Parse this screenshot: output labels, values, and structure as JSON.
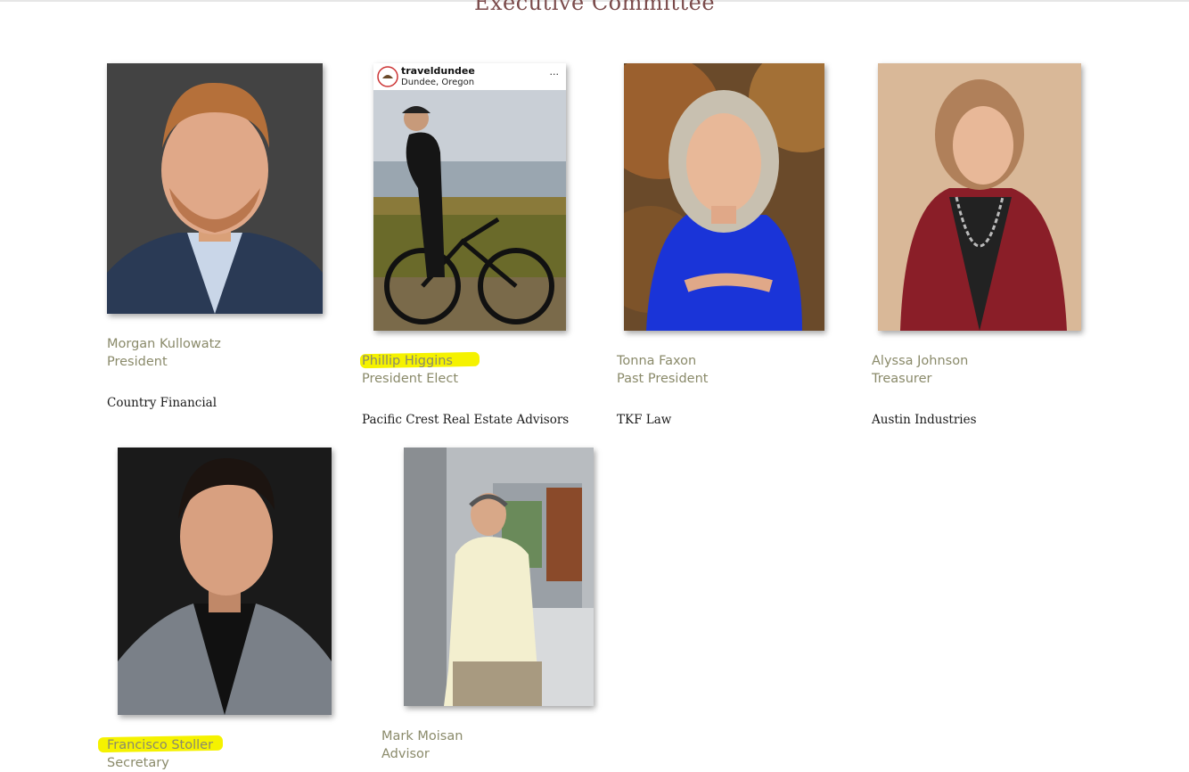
{
  "page": {
    "title": "Executive Committee"
  },
  "members": [
    {
      "name": "Morgan Kullowatz",
      "role": "President",
      "company": "Country Financial",
      "photo_icon": "portrait-man-beard-suit",
      "highlighted": false
    },
    {
      "name": "Phillip Higgins",
      "role": "President Elect",
      "company": "Pacific Crest Real Estate Advisors",
      "photo_icon": "portrait-cyclist-vineyard",
      "highlighted": true,
      "instagram": {
        "account": "traveldundee",
        "location": "Dundee, Oregon",
        "more": "···"
      }
    },
    {
      "name": "Tonna Faxon",
      "role": "Past President",
      "company": "TKF Law",
      "photo_icon": "portrait-woman-blue-dress",
      "highlighted": false
    },
    {
      "name": "Alyssa Johnson",
      "role": "Treasurer",
      "company": "Austin Industries",
      "photo_icon": "portrait-woman-red-cardigan",
      "highlighted": false
    },
    {
      "name": "Francisco Stoller",
      "role": "Secretary",
      "company": "",
      "photo_icon": "portrait-man-grey-blazer",
      "highlighted": true
    },
    {
      "name": "Mark Moisan",
      "role": "Advisor",
      "company": "",
      "photo_icon": "portrait-man-leaning-wall",
      "highlighted": false
    }
  ],
  "colors": {
    "title": "#7a4a4a",
    "name": "#8a8a6a",
    "highlight": "#f5f200"
  }
}
